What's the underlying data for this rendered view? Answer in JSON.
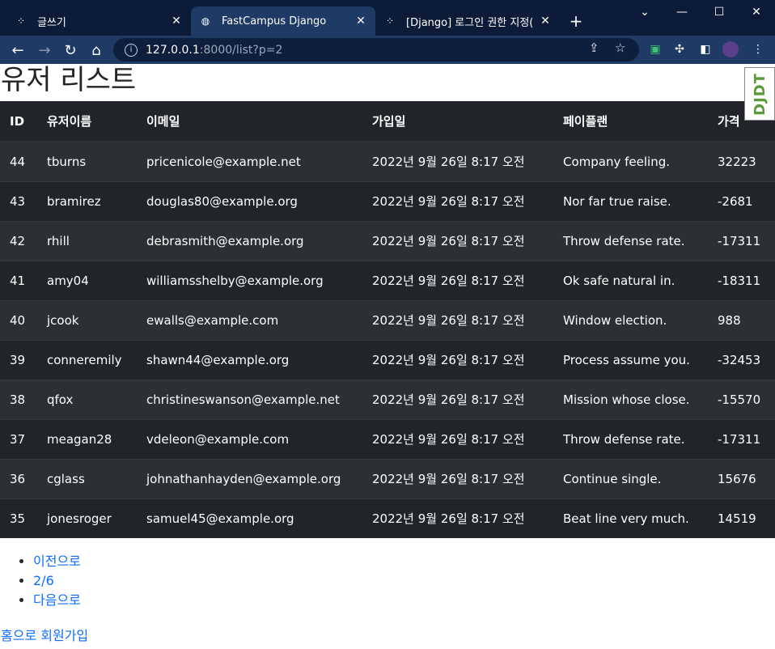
{
  "browser": {
    "tabs": [
      {
        "title": "글쓰기",
        "icon": "tistory-icon"
      },
      {
        "title": "FastCampus Django",
        "icon": "globe-icon"
      },
      {
        "title": "[Django] 로그인 권한 지정(log",
        "icon": "tistory-icon"
      }
    ],
    "new_tab_label": "+",
    "url_host": "127.0.0.1",
    "url_path": ":8000/list?p=2"
  },
  "page": {
    "title": "유저 리스트",
    "djdt_label": "DJDT",
    "table": {
      "headers": [
        "ID",
        "유저이름",
        "이메일",
        "가입일",
        "페이플랜",
        "가격"
      ],
      "rows": [
        [
          "44",
          "tburns",
          "pricenicole@example.net",
          "2022년 9월 26일 8:17 오전",
          "Company feeling.",
          "32223"
        ],
        [
          "43",
          "bramirez",
          "douglas80@example.org",
          "2022년 9월 26일 8:17 오전",
          "Nor far true raise.",
          "-2681"
        ],
        [
          "42",
          "rhill",
          "debrasmith@example.org",
          "2022년 9월 26일 8:17 오전",
          "Throw defense rate.",
          "-17311"
        ],
        [
          "41",
          "amy04",
          "williamsshelby@example.org",
          "2022년 9월 26일 8:17 오전",
          "Ok safe natural in.",
          "-18311"
        ],
        [
          "40",
          "jcook",
          "ewalls@example.com",
          "2022년 9월 26일 8:17 오전",
          "Window election.",
          "988"
        ],
        [
          "39",
          "conneremily",
          "shawn44@example.org",
          "2022년 9월 26일 8:17 오전",
          "Process assume you.",
          "-32453"
        ],
        [
          "38",
          "qfox",
          "christineswanson@example.net",
          "2022년 9월 26일 8:17 오전",
          "Mission whose close.",
          "-15570"
        ],
        [
          "37",
          "meagan28",
          "vdeleon@example.com",
          "2022년 9월 26일 8:17 오전",
          "Throw defense rate.",
          "-17311"
        ],
        [
          "36",
          "cglass",
          "johnathanhayden@example.org",
          "2022년 9월 26일 8:17 오전",
          "Continue single.",
          "15676"
        ],
        [
          "35",
          "jonesroger",
          "samuel45@example.org",
          "2022년 9월 26일 8:17 오전",
          "Beat line very much.",
          "14519"
        ]
      ]
    },
    "pager": {
      "prev": "이전으로",
      "current": "2/6",
      "next": "다음으로"
    },
    "links": {
      "home": "홈으로",
      "signup": "회원가입"
    }
  }
}
